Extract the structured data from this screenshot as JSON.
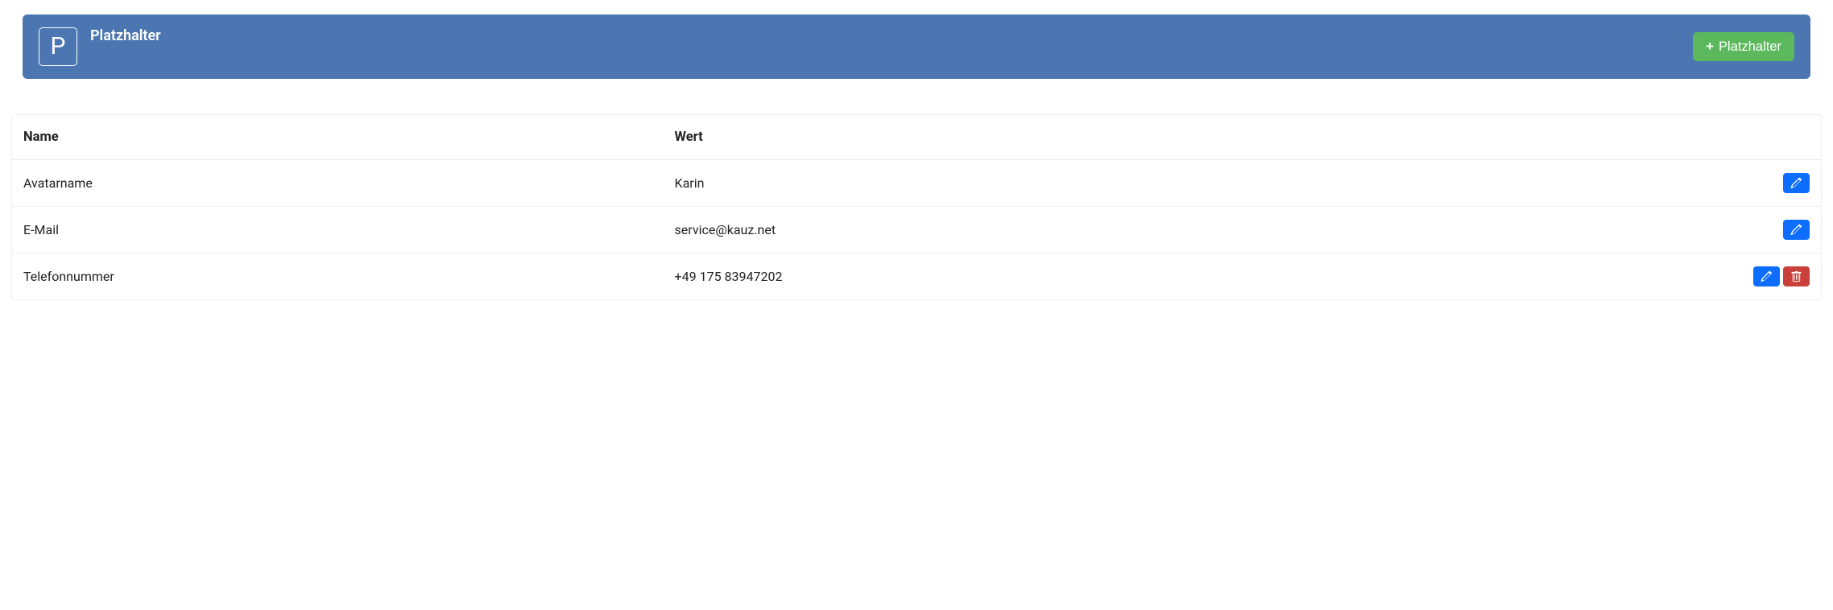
{
  "header": {
    "icon_letter": "P",
    "title": "Platzhalter",
    "add_button_label": "Platzhalter"
  },
  "table": {
    "columns": {
      "name": "Name",
      "value": "Wert"
    },
    "rows": [
      {
        "name": "Avatarname",
        "value": "Karin",
        "deletable": false
      },
      {
        "name": "E-Mail",
        "value": "service@kauz.net",
        "deletable": false
      },
      {
        "name": "Telefonnummer",
        "value": "+49 175 83947202",
        "deletable": true
      }
    ]
  }
}
